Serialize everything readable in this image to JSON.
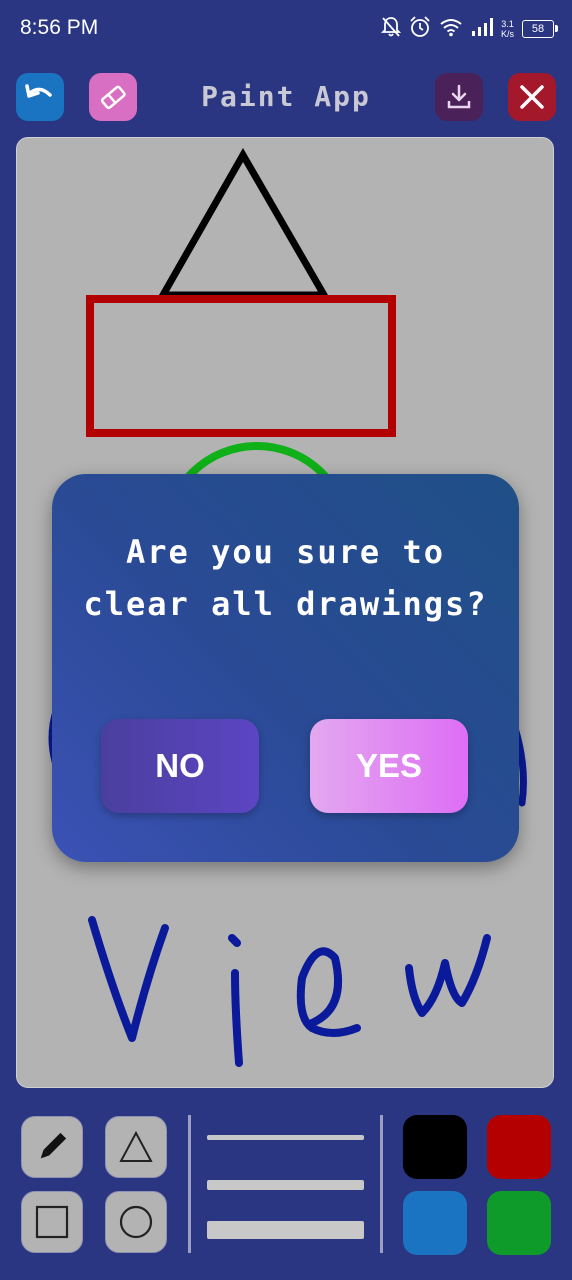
{
  "status_bar": {
    "time": "8:56 PM",
    "net_speed_value": "3.1",
    "net_speed_unit": "K/s",
    "battery": "58",
    "icons": [
      "bell-off-icon",
      "alarm-icon",
      "wifi-icon",
      "signal-icon",
      "battery-icon"
    ]
  },
  "toolbar": {
    "title": "Paint App",
    "undo_icon": "undo-icon",
    "eraser_icon": "eraser-icon",
    "save_icon": "download-icon",
    "clear_icon": "close-icon",
    "colors": {
      "undo": "#1b74c2",
      "eraser": "#d96fc3",
      "save": "#4a2158",
      "clear": "#a3192b"
    }
  },
  "canvas": {
    "background": "#b3b3b3",
    "drawn_shapes": [
      "triangle",
      "rectangle",
      "circle",
      "freehand-text"
    ]
  },
  "dialog": {
    "message_line1": "Are you sure to",
    "message_line2": "clear all drawings?",
    "no_label": "NO",
    "yes_label": "YES"
  },
  "tools": {
    "brush": "pencil-icon",
    "triangle": "triangle-icon",
    "rectangle": "square-icon",
    "circle": "circle-icon"
  },
  "stroke_widths": [
    "thin",
    "medium",
    "thick"
  ],
  "palette": [
    "#000000",
    "#b50000",
    "#1b74c2",
    "#0f9b2a"
  ]
}
